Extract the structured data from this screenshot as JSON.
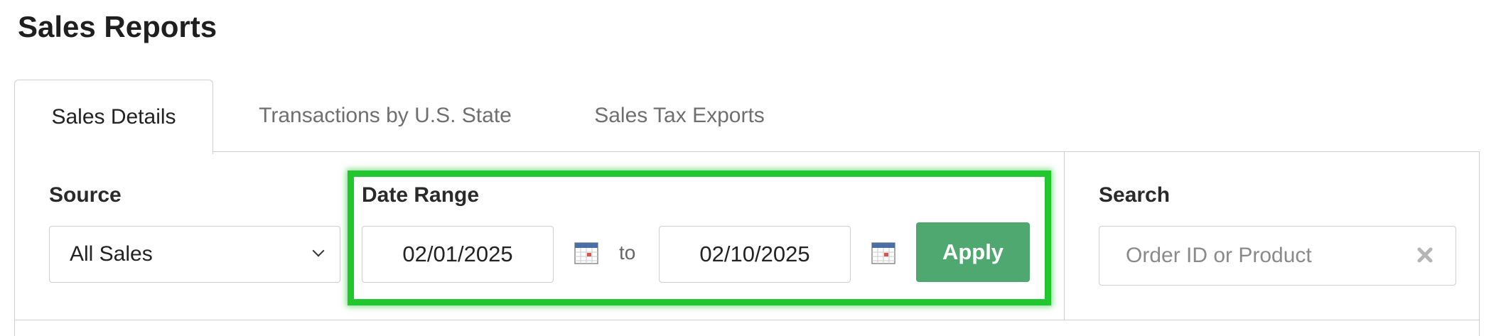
{
  "page": {
    "title": "Sales Reports"
  },
  "tabs": [
    {
      "label": "Sales Details",
      "active": true
    },
    {
      "label": "Transactions by U.S. State",
      "active": false
    },
    {
      "label": "Sales Tax Exports",
      "active": false
    }
  ],
  "filters": {
    "source": {
      "label": "Source",
      "value": "All Sales"
    },
    "date_range": {
      "label": "Date Range",
      "start": "02/01/2025",
      "separator": "to",
      "end": "02/10/2025",
      "apply_label": "Apply"
    },
    "search": {
      "label": "Search",
      "placeholder": "Order ID or Product",
      "value": ""
    }
  },
  "icons": {
    "calendar": "calendar-icon",
    "chevron": "chevron-down-icon",
    "clear": "close-icon"
  },
  "colors": {
    "apply_button": "#4ea86f",
    "highlight": "#22c62f",
    "border": "#cfcfcf"
  }
}
